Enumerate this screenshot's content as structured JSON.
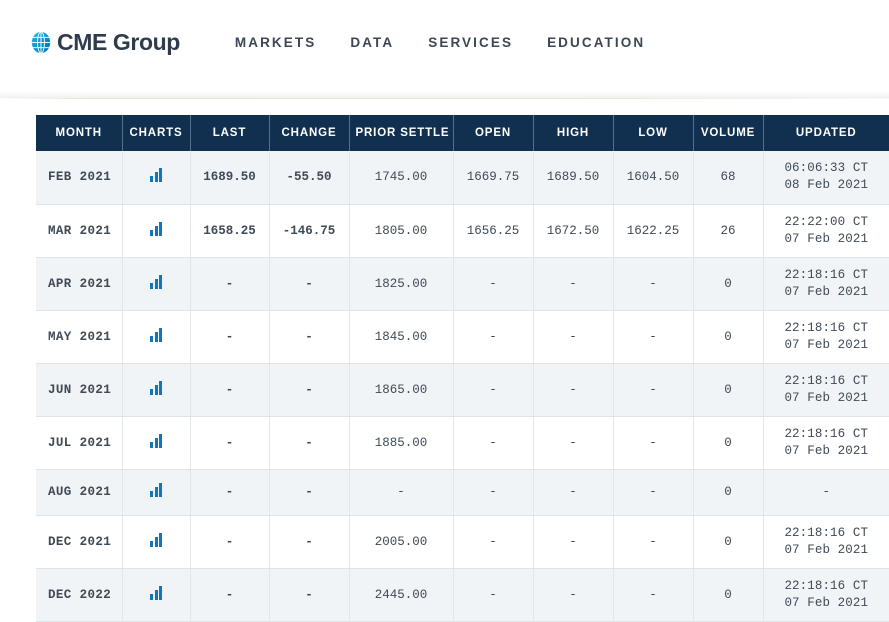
{
  "header": {
    "brand_name": "CME Group",
    "logo_icon": "globe-icon",
    "nav": [
      {
        "label": "Markets"
      },
      {
        "label": "Data"
      },
      {
        "label": "Services"
      },
      {
        "label": "Education"
      }
    ],
    "colors": {
      "brand_blue": "#0093d0",
      "brand_text": "#2f3c4c",
      "nav_text": "#3b4754"
    }
  },
  "table": {
    "columns": [
      {
        "key": "month",
        "label": "Month"
      },
      {
        "key": "charts",
        "label": "Charts"
      },
      {
        "key": "last",
        "label": "Last"
      },
      {
        "key": "change",
        "label": "Change"
      },
      {
        "key": "prior_settle",
        "label": "Prior Settle"
      },
      {
        "key": "open",
        "label": "Open"
      },
      {
        "key": "high",
        "label": "High"
      },
      {
        "key": "low",
        "label": "Low"
      },
      {
        "key": "volume",
        "label": "Volume"
      },
      {
        "key": "updated",
        "label": "Updated"
      }
    ],
    "chart_icon": "bar-chart-icon",
    "colors": {
      "header_bg": "#11304f",
      "row_odd_bg": "#f1f4f7",
      "row_even_bg": "#ffffff",
      "negative": "#ec0000",
      "chart_icon": "#1177bb"
    },
    "rows": [
      {
        "month": "FEB 2021",
        "last": "1689.50",
        "change": "-55.50",
        "change_dir": "down",
        "prior_settle": "1745.00",
        "open": "1669.75",
        "high": "1689.50",
        "low": "1604.50",
        "volume": "68",
        "updated_time": "06:06:33 CT",
        "updated_date": "08 Feb 2021"
      },
      {
        "month": "MAR 2021",
        "last": "1658.25",
        "change": "-146.75",
        "change_dir": "down",
        "prior_settle": "1805.00",
        "open": "1656.25",
        "high": "1672.50",
        "low": "1622.25",
        "volume": "26",
        "updated_time": "22:22:00 CT",
        "updated_date": "07 Feb 2021"
      },
      {
        "month": "APR 2021",
        "last": "-",
        "change": "-",
        "change_dir": "flat",
        "prior_settle": "1825.00",
        "open": "-",
        "high": "-",
        "low": "-",
        "volume": "0",
        "updated_time": "22:18:16 CT",
        "updated_date": "07 Feb 2021"
      },
      {
        "month": "MAY 2021",
        "last": "-",
        "change": "-",
        "change_dir": "flat",
        "prior_settle": "1845.00",
        "open": "-",
        "high": "-",
        "low": "-",
        "volume": "0",
        "updated_time": "22:18:16 CT",
        "updated_date": "07 Feb 2021"
      },
      {
        "month": "JUN 2021",
        "last": "-",
        "change": "-",
        "change_dir": "flat",
        "prior_settle": "1865.00",
        "open": "-",
        "high": "-",
        "low": "-",
        "volume": "0",
        "updated_time": "22:18:16 CT",
        "updated_date": "07 Feb 2021"
      },
      {
        "month": "JUL 2021",
        "last": "-",
        "change": "-",
        "change_dir": "flat",
        "prior_settle": "1885.00",
        "open": "-",
        "high": "-",
        "low": "-",
        "volume": "0",
        "updated_time": "22:18:16 CT",
        "updated_date": "07 Feb 2021"
      },
      {
        "month": "AUG 2021",
        "last": "-",
        "change": "-",
        "change_dir": "flat",
        "prior_settle": "-",
        "open": "-",
        "high": "-",
        "low": "-",
        "volume": "0",
        "updated_time": "-",
        "updated_date": ""
      },
      {
        "month": "DEC 2021",
        "last": "-",
        "change": "-",
        "change_dir": "flat",
        "prior_settle": "2005.00",
        "open": "-",
        "high": "-",
        "low": "-",
        "volume": "0",
        "updated_time": "22:18:16 CT",
        "updated_date": "07 Feb 2021"
      },
      {
        "month": "DEC 2022",
        "last": "-",
        "change": "-",
        "change_dir": "flat",
        "prior_settle": "2445.00",
        "open": "-",
        "high": "-",
        "low": "-",
        "volume": "0",
        "updated_time": "22:18:16 CT",
        "updated_date": "07 Feb 2021"
      }
    ]
  }
}
